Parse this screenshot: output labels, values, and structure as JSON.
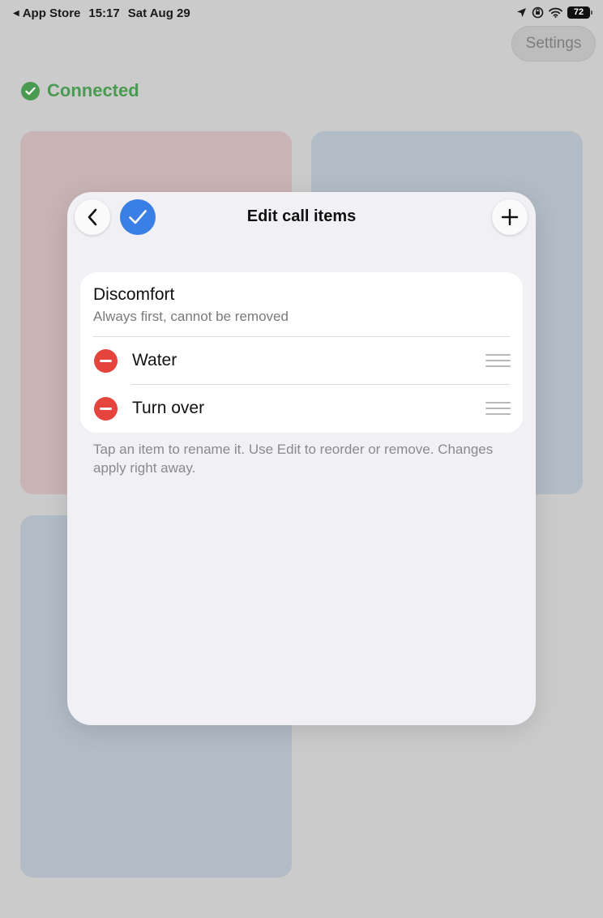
{
  "status_bar": {
    "back_app": "App Store",
    "time": "15:17",
    "date": "Sat Aug 29",
    "battery": "72"
  },
  "background": {
    "settings_label": "Settings",
    "connection_status": "Connected",
    "colors": {
      "connected": "#4a9a52",
      "tile_red": "#c9b4b5",
      "tile_blue": "#b2bcc6"
    }
  },
  "sheet": {
    "title": "Edit call items",
    "fixed_item": {
      "title": "Discomfort",
      "subtitle": "Always first, cannot be removed"
    },
    "items": [
      {
        "label": "Water"
      },
      {
        "label": "Turn over"
      }
    ],
    "footnote": "Tap an item to rename it. Use Edit to reorder or remove. Changes apply right away.",
    "colors": {
      "accent": "#3a7fe6",
      "remove": "#e5443d"
    },
    "icons": [
      "chevron-left-icon",
      "checkmark-icon",
      "plus-icon",
      "minus-icon",
      "drag-handle-icon"
    ]
  }
}
